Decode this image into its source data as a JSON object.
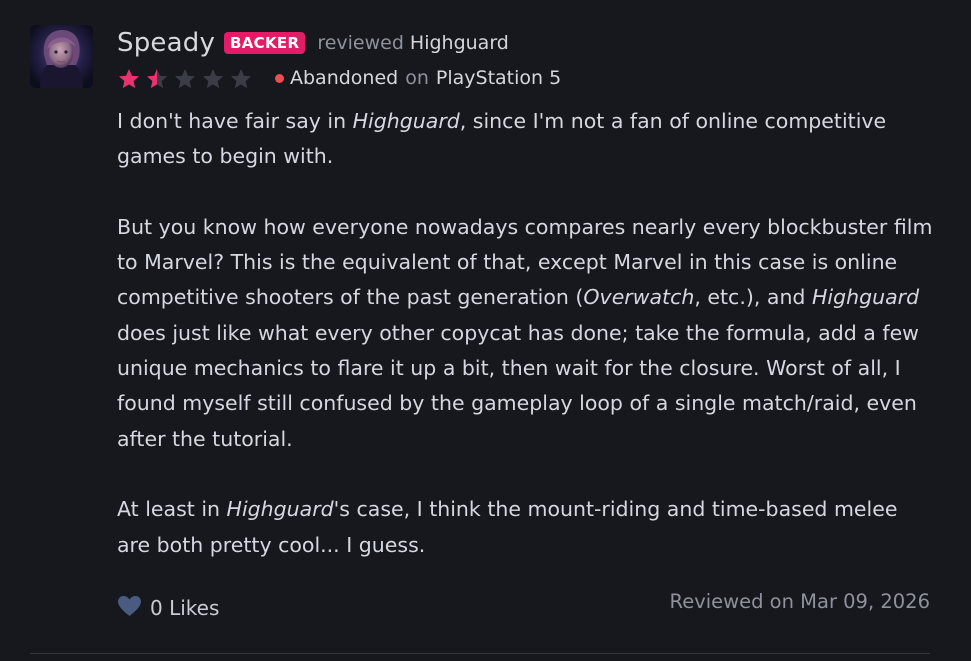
{
  "review": {
    "username": "Speady",
    "badge": "BACKER",
    "reviewed_word": "reviewed",
    "game": "Highguard",
    "rating": 1.5,
    "rating_max": 5,
    "status": "Abandoned",
    "on_word": "on",
    "platform": "PlayStation 5",
    "paragraphs": [
      [
        {
          "text": "I don't have fair say in "
        },
        {
          "text": "Highguard",
          "italic": true
        },
        {
          "text": ", since I'm not a fan of online competitive games to begin with."
        }
      ],
      [
        {
          "text": "But you know how everyone nowadays compares nearly every blockbuster film to Marvel? This is the equivalent of that, except Marvel in this case is online competitive shooters of the past generation ("
        },
        {
          "text": "Overwatch",
          "italic": true
        },
        {
          "text": ", etc.), and "
        },
        {
          "text": "Highguard",
          "italic": true
        },
        {
          "text": " does just like what every other copycat has done; take the formula, add a few unique mechanics to flare it up a bit, then wait for the closure. Worst of all, I found myself still confused by the gameplay loop of a single match/raid, even after the tutorial."
        }
      ],
      [
        {
          "text": "At least in "
        },
        {
          "text": "Highguard",
          "italic": true
        },
        {
          "text": "'s case, I think the mount-riding and time-based melee are both pretty cool... I guess."
        }
      ]
    ],
    "likes_label": "0 Likes",
    "reviewed_date": "Reviewed on Mar 09, 2026"
  },
  "icons": {
    "like": "heart-icon",
    "star": "star-icon"
  },
  "colors": {
    "background": "#17181d",
    "badge": "#e21d68",
    "star_filled": "#e8336f",
    "star_empty": "#3b3d46",
    "status_dot": "#ef4b50",
    "heart": "#4a5b82"
  }
}
